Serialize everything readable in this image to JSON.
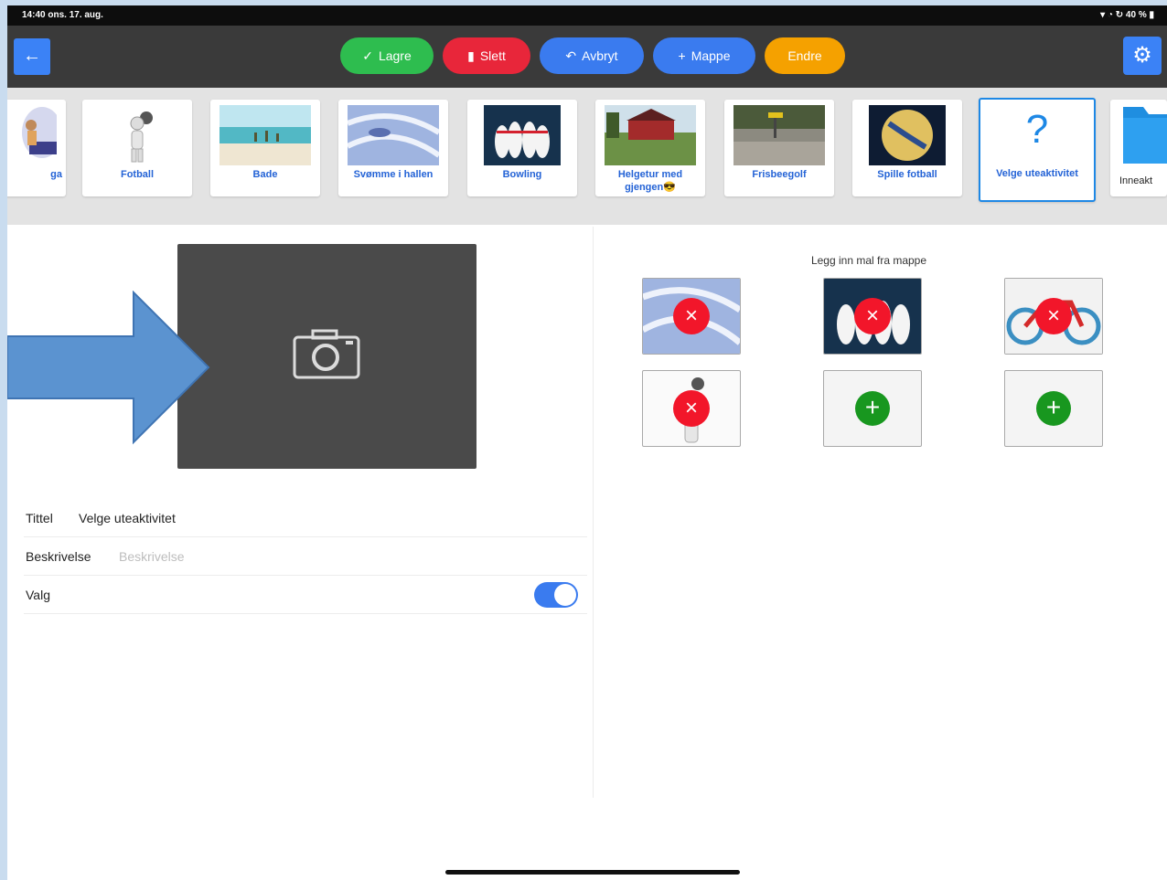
{
  "status": {
    "time": "14:40",
    "date": "ons. 17. aug.",
    "system": "40 %"
  },
  "nav": {
    "back_icon": "←",
    "save": "Lagre",
    "save_icon": "✓",
    "delete": "Slett",
    "delete_icon": "▮",
    "cancel": "Avbryt",
    "cancel_icon": "↶",
    "folder": "Mappe",
    "folder_icon": "+",
    "edit": "Endre",
    "settings_icon": "⚙"
  },
  "activities": [
    {
      "label": "ga"
    },
    {
      "label": "Fotball"
    },
    {
      "label": "Bade"
    },
    {
      "label": "Svømme i hallen"
    },
    {
      "label": "Bowling"
    },
    {
      "label": "Helgetur med gjengen😎"
    },
    {
      "label": "Frisbeegolf"
    },
    {
      "label": "Spille fotball"
    },
    {
      "label": "Velge uteaktivitet",
      "icon": "?"
    },
    {
      "label": "Inneakt"
    }
  ],
  "form": {
    "title_label": "Tittel",
    "title_value": "Velge uteaktivitet",
    "desc_label": "Beskrivelse",
    "desc_placeholder": "Beskrivelse",
    "choice_label": "Valg",
    "choice_enabled": true
  },
  "templates": {
    "title": "Legg inn mal fra mappe",
    "remove_icon": "×",
    "add_icon": "+"
  },
  "colors": {
    "accent": "#3b82f6",
    "green": "#2ebd4f",
    "red": "#e8263a",
    "orange": "#f5a100"
  }
}
